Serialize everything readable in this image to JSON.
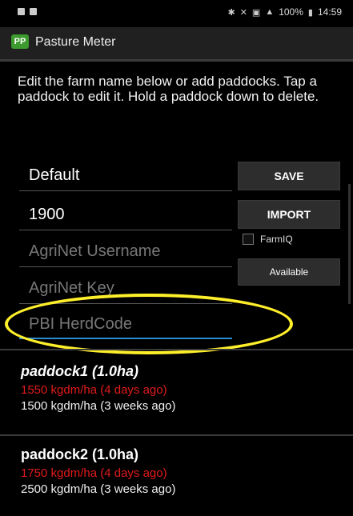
{
  "status_bar": {
    "battery_text": "100%",
    "time": "14:59"
  },
  "app": {
    "logo_text": "PP",
    "title": "Pasture Meter"
  },
  "instructions": "Edit the farm name below or add paddocks. Tap a paddock to edit it. Hold a paddock down to delete.",
  "fields": {
    "farm_name": "Default",
    "number": "1900",
    "agrinet_username_placeholder": "AgriNet Username",
    "agrinet_key_placeholder": "AgriNet Key",
    "pbi_herdcode_placeholder": "PBI HerdCode"
  },
  "buttons": {
    "save": "SAVE",
    "import": "IMPORT",
    "farmiq_label": "FarmIQ",
    "available": "Available"
  },
  "paddocks": [
    {
      "name": "paddock1 (1.0ha)",
      "latest": "1550 kgdm/ha (4 days ago)",
      "previous": "1500 kgdm/ha (3 weeks ago)"
    },
    {
      "name": "paddock2 (1.0ha)",
      "latest": "1750 kgdm/ha (4 days ago)",
      "previous": "2500 kgdm/ha (3 weeks ago)"
    }
  ],
  "colors": {
    "highlight": "#ffef2b",
    "warning_text": "#e21b1b",
    "logo_bg": "#3d9a2f"
  }
}
